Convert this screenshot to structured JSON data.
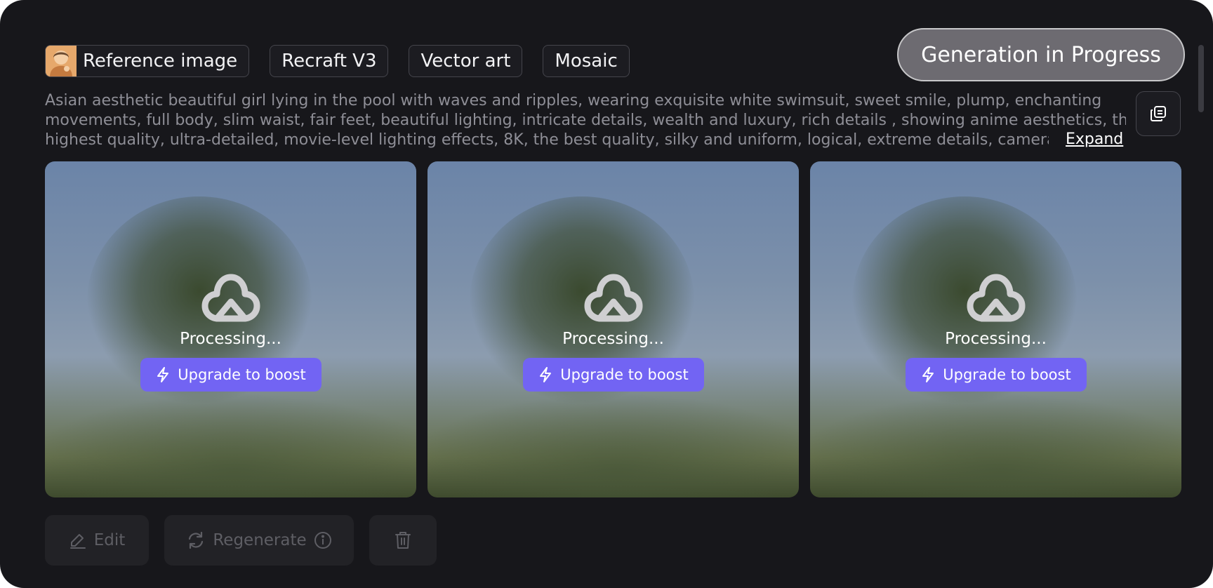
{
  "tags": [
    {
      "label": "Reference image"
    },
    {
      "label": "Recraft V3"
    },
    {
      "label": "Vector art"
    },
    {
      "label": "Mosaic"
    }
  ],
  "status_button": "Generation in Progress",
  "prompt": {
    "lines": [
      "Asian aesthetic beautiful girl lying in the pool with waves and ripples, wearing exquisite white swimsuit, sweet smile, plump, enchanting",
      "movements, full body, slim waist, fair feet, beautiful lighting, intricate details, wealth and luxury, rich details , showing anime aesthetics, the",
      "highest quality, ultra-detailed, movie-level lighting effects, 8K, the best quality, silky and uniform, logical, extreme details, camera tr..."
    ],
    "expand_label": "Expand"
  },
  "cards": [
    {
      "status": "Processing...",
      "boost_label": "Upgrade to boost"
    },
    {
      "status": "Processing...",
      "boost_label": "Upgrade to boost"
    },
    {
      "status": "Processing...",
      "boost_label": "Upgrade to boost"
    }
  ],
  "actions": {
    "edit_label": "Edit",
    "regenerate_label": "Regenerate"
  },
  "icons": {
    "copy": "copy-icon",
    "logo": "cloud-logo-icon",
    "boost": "lightning-icon",
    "edit": "pencil-icon",
    "regenerate": "refresh-icon",
    "info": "info-icon",
    "delete": "trash-icon"
  },
  "colors": {
    "accent": "#7264f3",
    "background": "#17171b"
  }
}
